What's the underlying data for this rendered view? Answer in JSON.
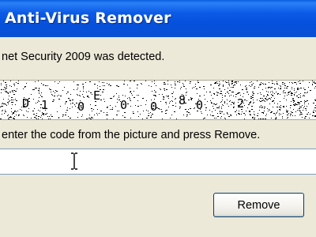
{
  "window": {
    "title": "Anti-Virus Remover"
  },
  "dialog": {
    "message": "net Security 2009 was detected.",
    "instruction": "enter the code from the picture and press Remove.",
    "captcha": {
      "characters": [
        "D",
        "1",
        "0",
        "E",
        "0",
        "0",
        "8",
        "0",
        "2"
      ]
    },
    "code_input": {
      "value": ""
    },
    "remove_label": "Remove"
  },
  "colors": {
    "titlebar": "#0a55e0",
    "title_text": "#ffffff",
    "dialog_background": "#ece9d8",
    "button_border": "#003c74"
  },
  "icons": {
    "cursor": "ibeam-cursor-icon"
  }
}
